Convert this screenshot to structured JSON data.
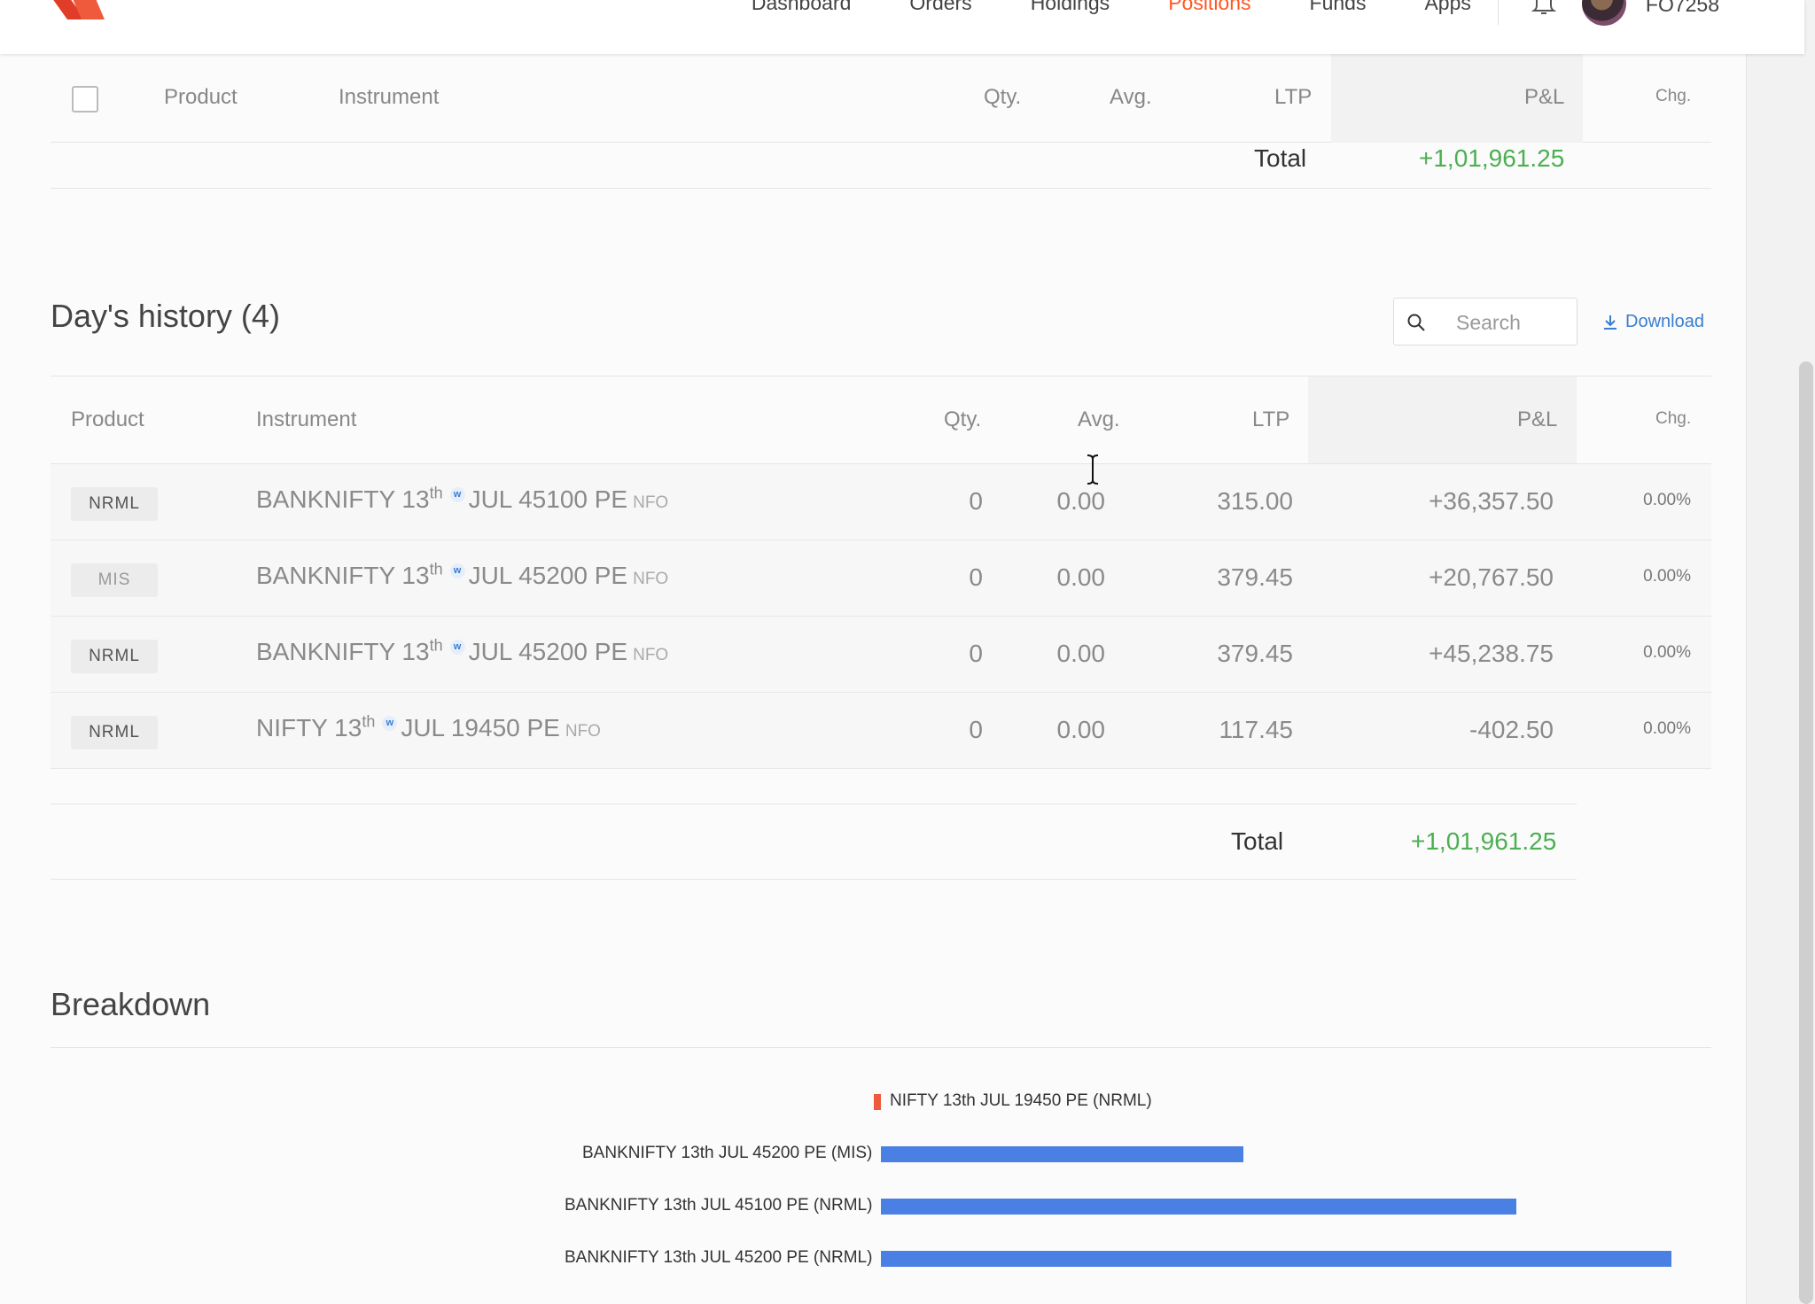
{
  "nav": {
    "items": [
      "Dashboard",
      "Orders",
      "Holdings",
      "Positions",
      "Funds",
      "Apps"
    ],
    "active": "Positions",
    "user_id": "FO7258"
  },
  "positions": {
    "columns": [
      "Product",
      "Instrument",
      "Qty.",
      "Avg.",
      "LTP",
      "P&L",
      "Chg."
    ],
    "total_label": "Total",
    "total_value": "+1,01,961.25"
  },
  "history": {
    "title": "Day's history (4)",
    "search_placeholder": "Search",
    "download_label": "Download",
    "columns": [
      "Product",
      "Instrument",
      "Qty.",
      "Avg.",
      "LTP",
      "P&L",
      "Chg."
    ],
    "rows": [
      {
        "product": "NRML",
        "inst_pre": "BANKNIFTY 13",
        "inst_sup": "th",
        "weekly": "w",
        "inst_post": "JUL 45100 PE",
        "exchange": "NFO",
        "qty": "0",
        "avg": "0.00",
        "ltp": "315.00",
        "pnl": "+36,357.50",
        "chg": "0.00%"
      },
      {
        "product": "MIS",
        "inst_pre": "BANKNIFTY 13",
        "inst_sup": "th",
        "weekly": "w",
        "inst_post": "JUL 45200 PE",
        "exchange": "NFO",
        "qty": "0",
        "avg": "0.00",
        "ltp": "379.45",
        "pnl": "+20,767.50",
        "chg": "0.00%"
      },
      {
        "product": "NRML",
        "inst_pre": "BANKNIFTY 13",
        "inst_sup": "th",
        "weekly": "w",
        "inst_post": "JUL 45200 PE",
        "exchange": "NFO",
        "qty": "0",
        "avg": "0.00",
        "ltp": "379.45",
        "pnl": "+45,238.75",
        "chg": "0.00%"
      },
      {
        "product": "NRML",
        "inst_pre": "NIFTY 13",
        "inst_sup": "th",
        "weekly": "w",
        "inst_post": "JUL 19450 PE",
        "exchange": "NFO",
        "qty": "0",
        "avg": "0.00",
        "ltp": "117.45",
        "pnl": "-402.50",
        "chg": "0.00%"
      }
    ],
    "total_label": "Total",
    "total_value": "+1,01,961.25"
  },
  "breakdown": {
    "title": "Breakdown"
  },
  "colors": {
    "accent": "#ff5722",
    "profit": "#4caf50",
    "link": "#387ed1",
    "bar_positive": "#4a7fe4",
    "bar_negative": "#f05a3c"
  },
  "chart_data": {
    "type": "bar",
    "orientation": "horizontal",
    "categories": [
      "NIFTY 13th JUL 19450 PE (NRML)",
      "BANKNIFTY 13th JUL 45200 PE (MIS)",
      "BANKNIFTY 13th JUL 45100 PE (NRML)",
      "BANKNIFTY 13th JUL 45200 PE (NRML)"
    ],
    "values": [
      -402.5,
      20767.5,
      36357.5,
      45238.75
    ]
  }
}
